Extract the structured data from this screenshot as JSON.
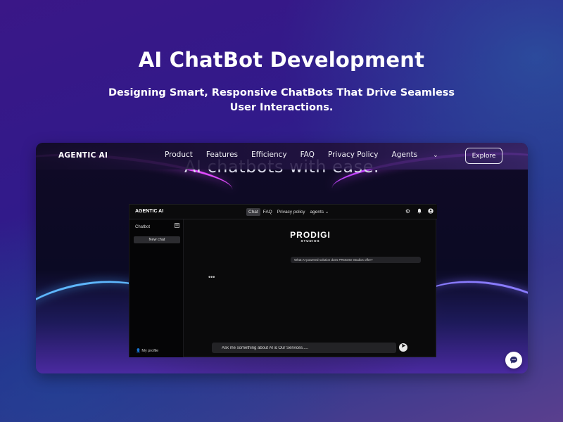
{
  "hero": {
    "title": "AI ChatBot Development",
    "subtitle": "Designing Smart, Responsive ChatBots That Drive Seamless User Interactions."
  },
  "site_nav": {
    "logo": "AGENTIC AI",
    "links": [
      "Product",
      "Features",
      "Efficiency",
      "FAQ",
      "Privacy Policy",
      "Agents"
    ],
    "explore_label": "Explore"
  },
  "background_text": "AI chatbots with ease.",
  "app": {
    "logo": "AGENTIC AI",
    "menu": [
      "Chat",
      "FAQ",
      "Privacy policy",
      "agents"
    ],
    "active_menu": "Chat",
    "icons": [
      "gear-icon",
      "bell-icon",
      "user-icon"
    ],
    "sidebar": {
      "title": "Chatbot",
      "new_chat_label": "New chat",
      "profile_label": "My profile"
    },
    "brand": {
      "main": "PRODIGI",
      "sub": "STUDIOS"
    },
    "question": "What AI-powered solution does PRODIGI Studios offer?",
    "typing_indicator": "•••",
    "input_placeholder": "Ask me something about AI & Our Services....."
  },
  "colors": {
    "accent_pink": "#e24cff",
    "accent_blue": "#5fb8ff",
    "app_background": "#0a0a0b"
  }
}
